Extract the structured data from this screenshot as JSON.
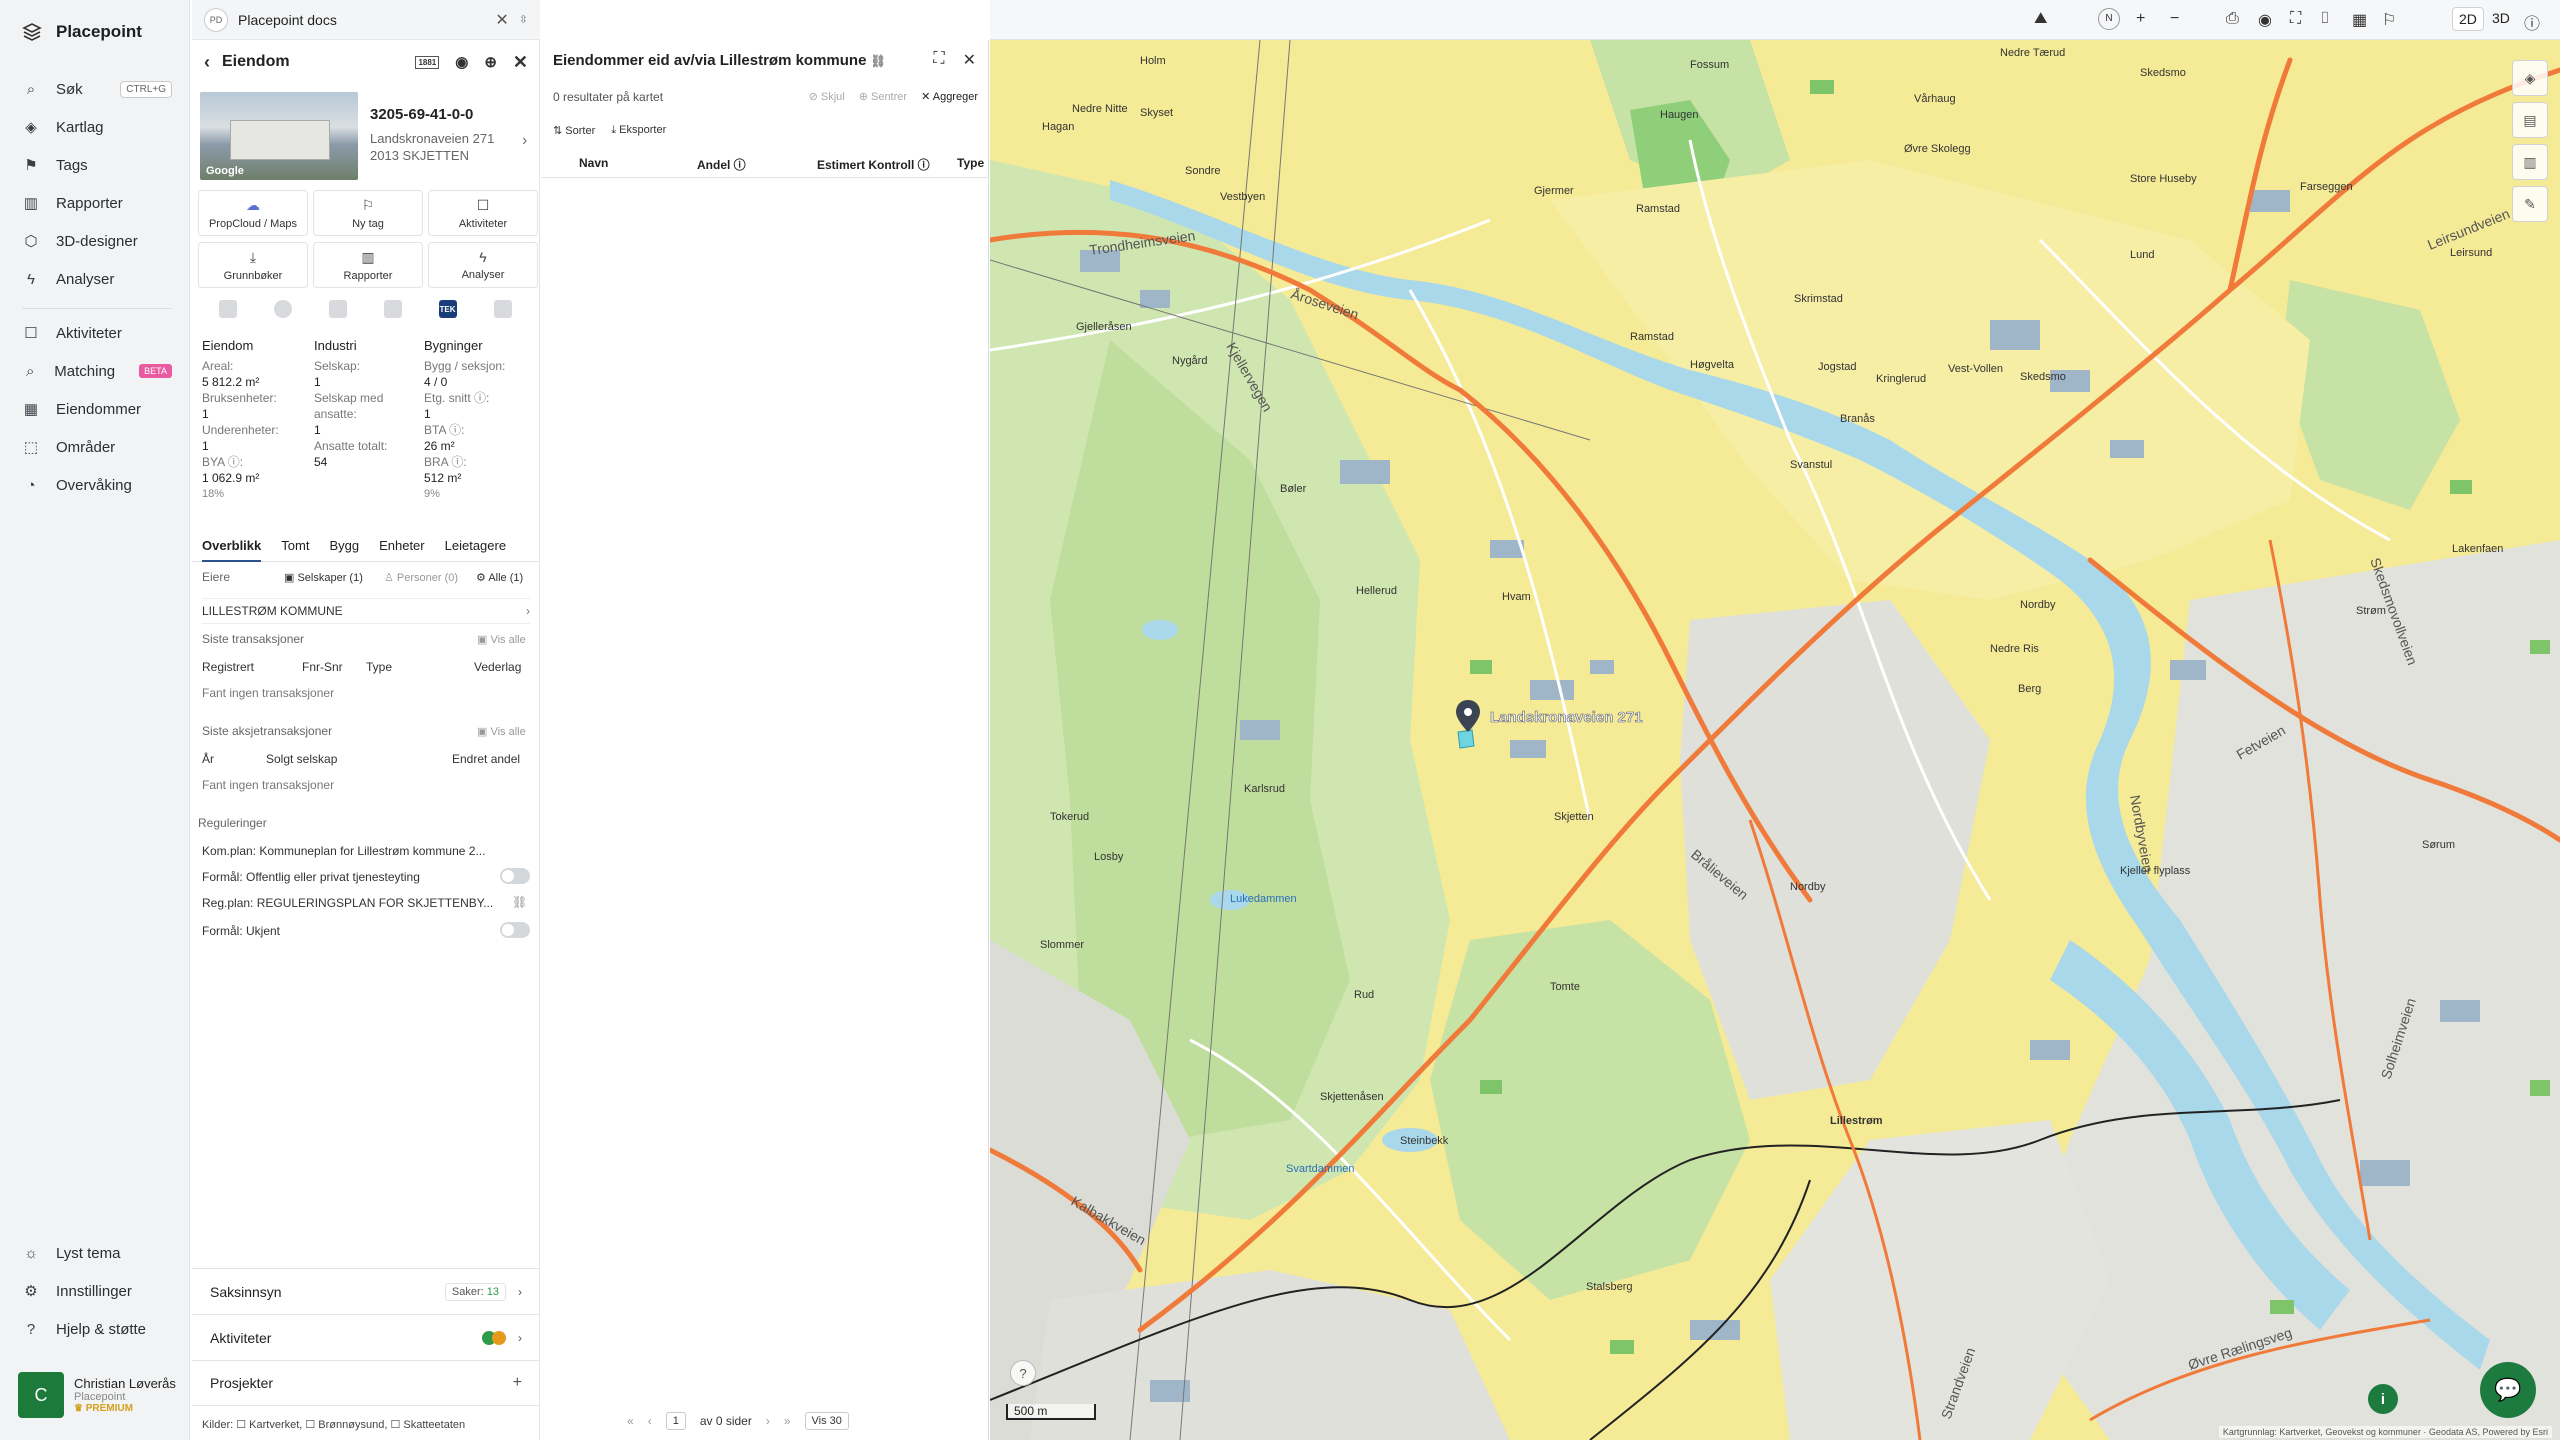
{
  "nav": {
    "brand": "Placepoint",
    "items": [
      {
        "label": "Søk",
        "icon": "search-icon",
        "shortcut": "CTRL+G"
      },
      {
        "label": "Kartlag",
        "icon": "layers-icon"
      },
      {
        "label": "Tags",
        "icon": "bookmark-icon"
      },
      {
        "label": "Rapporter",
        "icon": "chart-icon"
      },
      {
        "label": "3D-designer",
        "icon": "cube-icon"
      },
      {
        "label": "Analyser",
        "icon": "bolt-icon"
      },
      {
        "label": "Aktiviteter",
        "icon": "chat-icon"
      },
      {
        "label": "Matching",
        "icon": "search-icon",
        "badge": "BETA"
      },
      {
        "label": "Eiendommer",
        "icon": "grid-icon"
      },
      {
        "label": "Områder",
        "icon": "area-icon"
      },
      {
        "label": "Overvåking",
        "icon": "gauge-icon"
      }
    ],
    "bottom": [
      {
        "label": "Lyst tema",
        "icon": "sun-icon"
      },
      {
        "label": "Innstillinger",
        "icon": "gear-icon"
      },
      {
        "label": "Hjelp & støtte",
        "icon": "help-icon"
      }
    ],
    "user": {
      "initial": "C",
      "name": "Christian Løverås",
      "org": "Placepoint",
      "plan": "PREMIUM"
    }
  },
  "panel1": {
    "docs_badge": "PD",
    "docs_title": "Placepoint docs",
    "header": "Eiendom",
    "tag_1881": "1881",
    "photo_logo": "Google",
    "property_id": "3205-69-41-0-0",
    "address_line1": "Landskronaveien 271",
    "address_line2": "2013 SKJETTEN",
    "tiles": [
      {
        "label": "PropCloud / Maps",
        "icon": "cloud-icon"
      },
      {
        "label": "Ny tag",
        "icon": "bookmark-icon"
      },
      {
        "label": "Aktiviteter",
        "icon": "chat-icon"
      },
      {
        "label": "Grunnbøker",
        "icon": "download-icon"
      },
      {
        "label": "Rapporter",
        "icon": "chart-icon"
      },
      {
        "label": "Analyser",
        "icon": "bolt-icon"
      }
    ],
    "tek_label": "TEK",
    "stats": {
      "eiendom": {
        "title": "Eiendom",
        "areal_l": "Areal:",
        "areal_v": "5 812.2 m²",
        "bruks_l": "Bruksenheter:",
        "bruks_v": "1",
        "under_l": "Underenheter:",
        "under_v": "1",
        "bya_l": "BYA ⓘ:",
        "bya_v": "1 062.9 m²",
        "bya_p": "18%"
      },
      "industri": {
        "title": "Industri",
        "selskap_l": "Selskap:",
        "selskap_v": "1",
        "med_l": "Selskap med ansatte:",
        "med_v": "1",
        "ansatte_l": "Ansatte totalt:",
        "ansatte_v": "54"
      },
      "bygninger": {
        "title": "Bygninger",
        "bygg_l": "Bygg / seksjon:",
        "bygg_v": "4 / 0",
        "etg_l": "Etg. snitt ⓘ:",
        "etg_v": "1",
        "bta_l": "BTA ⓘ:",
        "bta_v": "26 m²",
        "bra_l": "BRA ⓘ:",
        "bra_v": "512 m²",
        "bra_p": "9%"
      }
    },
    "tabs": [
      "Overblikk",
      "Tomt",
      "Bygg",
      "Enheter",
      "Leietagere"
    ],
    "owners": {
      "label": "Eiere",
      "selskaper": "Selskaper (1)",
      "personer": "Personer (0)",
      "alle": "Alle (1)",
      "owner": "LILLESTRØM KOMMUNE"
    },
    "transactions": {
      "label": "Siste transaksjoner",
      "vis_alle": "Vis alle",
      "cols": [
        "Registrert",
        "Fnr-Snr",
        "Type",
        "Vederlag"
      ],
      "empty": "Fant ingen transaksjoner"
    },
    "share_transactions": {
      "label": "Siste aksjetransaksjoner",
      "vis_alle": "Vis alle",
      "cols": [
        "År",
        "Solgt selskap",
        "Endret andel"
      ],
      "empty": "Fant ingen transaksjoner"
    },
    "regulations": {
      "label": "Reguleringer",
      "rows": [
        "Kom.plan: Kommuneplan for Lillestrøm kommune 2...",
        "Formål: Offentlig eller privat tjenesteyting",
        "Reg.plan: REGULERINGSPLAN FOR SKJETTENBY...",
        "Formål: Ukjent"
      ]
    },
    "accordions": {
      "saksinnsyn": "Saksinnsyn",
      "saker_label": "Saker:",
      "saker_count": "13",
      "aktiviteter": "Aktiviteter",
      "prosjekter": "Prosjekter"
    },
    "sources": "Kilder:  ☐ Kartverket,  ☐ Brønnøysund,  ☐ Skatteetaten"
  },
  "panel2": {
    "title": "Eiendommer eid av/via Lillestrøm kommune",
    "count": "0 resultater på kartet",
    "actions": {
      "skjul": "Skjul",
      "sentrer": "Sentrer",
      "aggreger": "Aggreger"
    },
    "tools": {
      "sorter": "Sorter",
      "eksporter": "Eksporter"
    },
    "columns": [
      "Navn",
      "Andel ⓘ",
      "Estimert Kontroll ⓘ",
      "Type"
    ],
    "pager": {
      "page": "1",
      "of_pages": "av 0 sider",
      "per_page": "Vis 30"
    }
  },
  "map": {
    "toggle_2d": "2D",
    "toggle_3d": "3D",
    "compass": "N",
    "marker_label": "Landskronaveien 271",
    "scale": "500 m",
    "attribution": "Kartgrunnlag: Kartverket, Geovekst og kommuner · Geodata AS, Powered by Esri",
    "places": [
      "Holm",
      "Fossum",
      "Nedre Tærud",
      "Skedsmo",
      "Haugen",
      "Hagan",
      "Nedre Nitte",
      "Skyset",
      "Sondre",
      "Vestbyen",
      "Gjermer",
      "Ramstad",
      "Vårhaug",
      "Øvre Skolegg",
      "Store Huseby",
      "Lund",
      "Farseggen",
      "Leirsund",
      "Høgvelta",
      "Ramstad",
      "Svanstul",
      "Skrimstad",
      "Jogstad",
      "Kringlerud",
      "Branås",
      "Vest-Vollen",
      "Skedsmo",
      "Nordby",
      "Strøm",
      "Lakenfaen",
      "Nedre Ris",
      "Berg",
      "Lillestrøm",
      "Kjeller flyplass",
      "Hvam",
      "Skjetten",
      "Nordby",
      "Gjelleråsen",
      "Nygård",
      "Bøler",
      "Karlsrud",
      "Hellerud",
      "Sørum",
      "Lukedammen",
      "Tokerud",
      "Losby",
      "Slommer",
      "Skjettenåsen",
      "Steinbekk",
      "Svartdammen",
      "Stalsberg",
      "Rud",
      "Tomte"
    ],
    "roads": [
      "Trondheimsveien",
      "Åroseveien",
      "Leirsundveien",
      "Brålieveien",
      "Fetveien",
      "Skedsmovollveien",
      "Øvre Rælingsveg",
      "Strandveien",
      "Solheimveien",
      "Nordbyveien",
      "Kjellervegen",
      "Kalbakkveien"
    ]
  }
}
